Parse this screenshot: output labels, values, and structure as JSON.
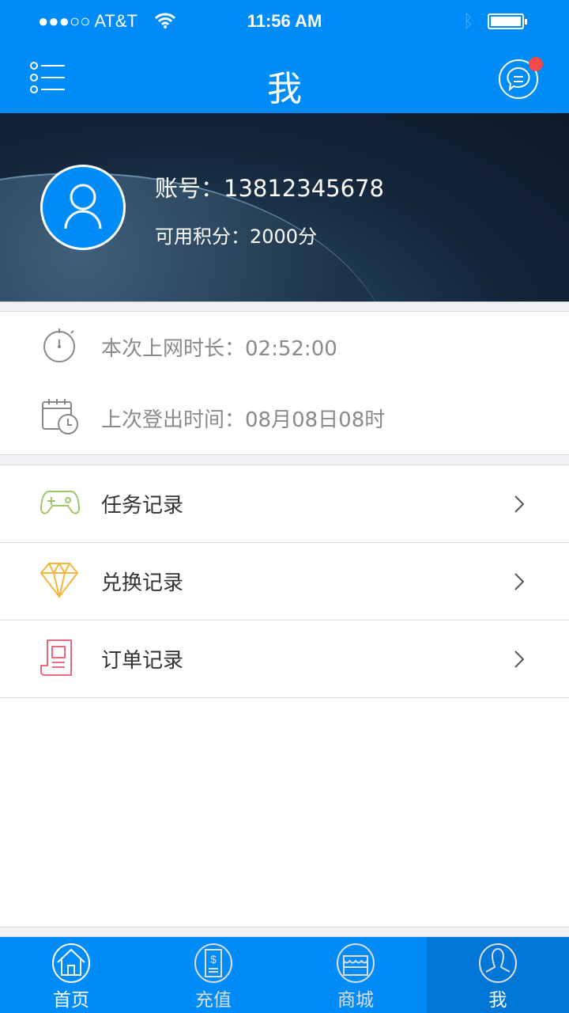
{
  "status_bar": {
    "carrier": "●●●○○ AT&T",
    "time": "11:56 AM"
  },
  "header": {
    "title": "我",
    "menu_icon": "list-icon",
    "message_icon": "chat-bubble-icon",
    "has_notification": true
  },
  "profile": {
    "account_label": "账号：13812345678",
    "points_label": "可用积分：2000分"
  },
  "info": [
    {
      "icon": "stopwatch-icon",
      "text": "本次上网时长：02:52:00"
    },
    {
      "icon": "calendar-clock-icon",
      "text": "上次登出时间：08月08日08时"
    }
  ],
  "menu": [
    {
      "icon": "gamepad-icon",
      "label": "任务记录",
      "color": "#9cc76a"
    },
    {
      "icon": "diamond-icon",
      "label": "兑换记录",
      "color": "#f4b63f"
    },
    {
      "icon": "receipt-icon",
      "label": "订单记录",
      "color": "#e86a7e"
    }
  ],
  "tabs": [
    {
      "icon": "home-icon",
      "label": "首页"
    },
    {
      "icon": "recharge-icon",
      "label": "充值"
    },
    {
      "icon": "shop-icon",
      "label": "商城"
    },
    {
      "icon": "user-icon",
      "label": "我",
      "active": true
    }
  ],
  "colors": {
    "primary": "#008cf8",
    "active_tab": "#0076d6",
    "badge": "#f54a4a"
  }
}
